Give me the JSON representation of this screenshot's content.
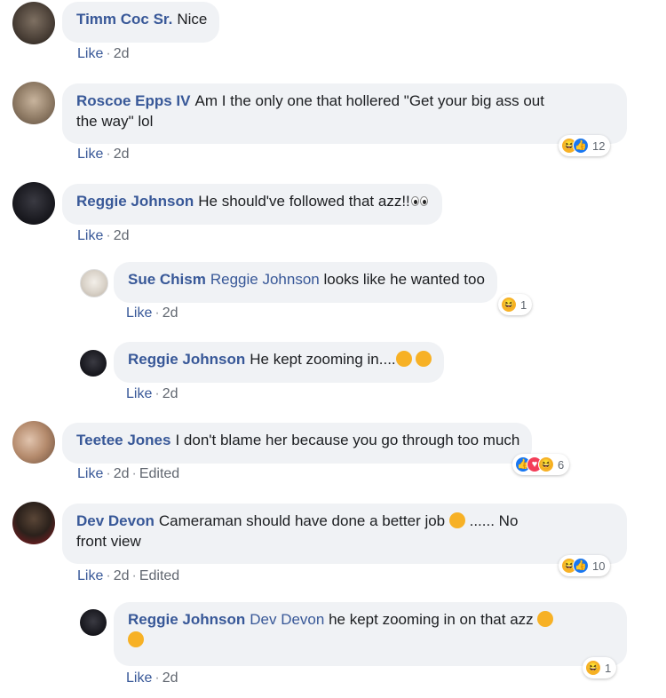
{
  "comments": [
    {
      "name": "Timm Coc Sr.",
      "text": "Nice",
      "like": "Like",
      "time": "2d"
    },
    {
      "name": "Roscoe Epps IV",
      "text": "Am I the only one that hollered \"Get your big ass out",
      "text2": "the way\" lol",
      "like": "Like",
      "time": "2d",
      "reaction_count": "12"
    },
    {
      "name": "Reggie Johnson",
      "text": "He should've followed that azz!!",
      "like": "Like",
      "time": "2d"
    },
    {
      "name": "Sue Chism",
      "mention": "Reggie Johnson",
      "text": "looks like he wanted too",
      "like": "Like",
      "time": "2d",
      "reaction_count": "1"
    },
    {
      "name": "Reggie Johnson",
      "text": "He kept zooming in....",
      "like": "Like",
      "time": "2d"
    },
    {
      "name": "Teetee Jones",
      "text": "I don't blame her because you go through too much",
      "like": "Like",
      "time": "2d",
      "edited": "Edited",
      "reaction_count": "6"
    },
    {
      "name": "Dev Devon",
      "text": "Cameraman should have done a better job",
      "text_after": "...... No",
      "text2": "front view",
      "like": "Like",
      "time": "2d",
      "edited": "Edited",
      "reaction_count": "10"
    },
    {
      "name": "Reggie Johnson",
      "mention": "Dev Devon",
      "text": "he kept zooming in on that azz",
      "like": "Like",
      "time": "2d",
      "reaction_count": "1"
    }
  ],
  "separator": "·",
  "colors": {
    "name": "#385898",
    "bubble": "#f0f2f5",
    "haha": "#f7b125",
    "like": "#1877f2",
    "love": "#f33e58"
  }
}
